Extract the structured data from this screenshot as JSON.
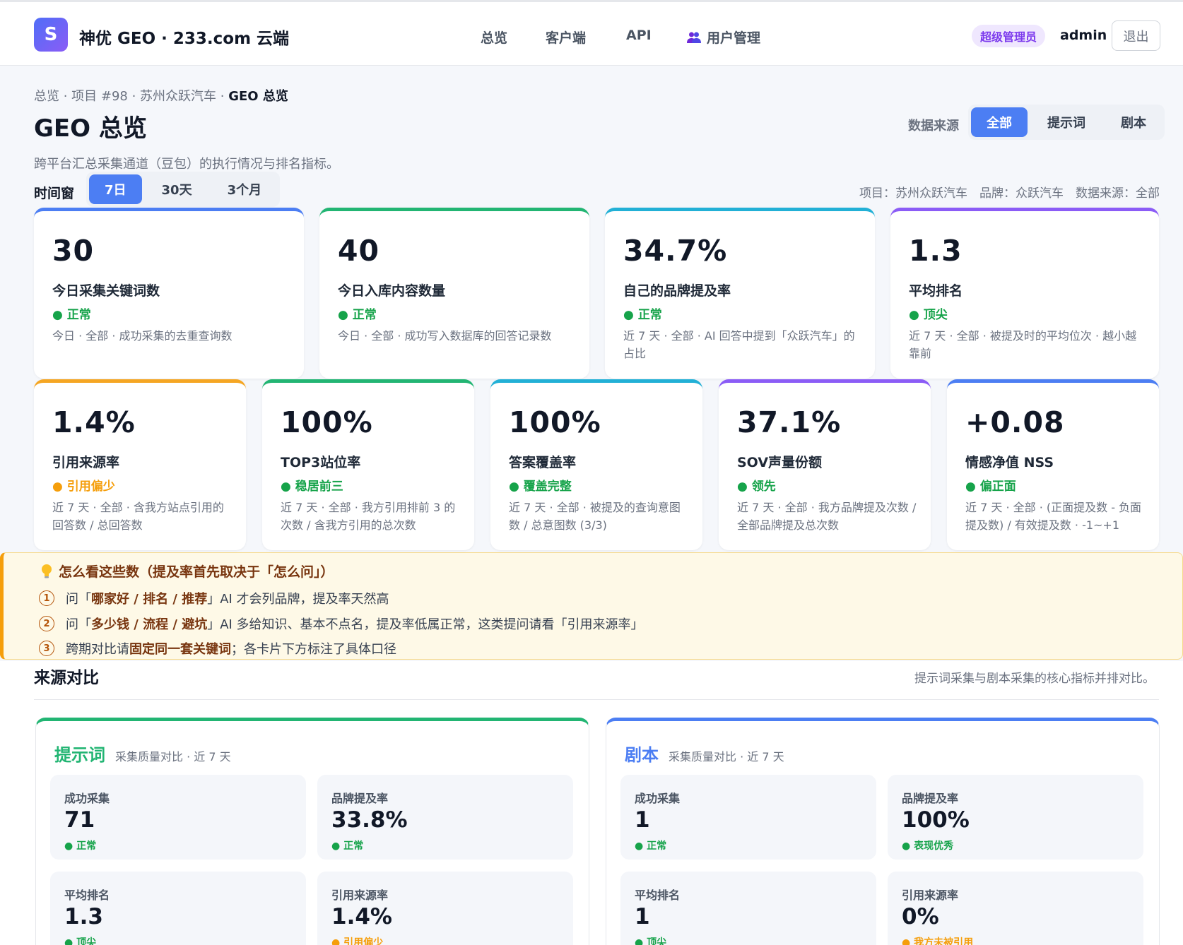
{
  "header": {
    "logo_letter": "S",
    "brand": "神优 GEO · 233.com 云端",
    "nav": [
      "总览",
      "客户端",
      "API",
      "用户管理"
    ],
    "role": "超级管理员",
    "user": "admin",
    "logout": "退出"
  },
  "page": {
    "breadcrumb_prefix": "总览 · 项目 #98 · 苏州众跃汽车 · ",
    "breadcrumb_current": "GEO 总览",
    "title": "GEO 总览",
    "subtitle": "跨平台汇总采集通道（豆包）的执行情况与排名指标。",
    "source_label": "数据来源",
    "source_options": [
      "全部",
      "提示词",
      "剧本"
    ],
    "source_selected": "全部",
    "time_label": "时间窗",
    "time_options": [
      "7日",
      "30天",
      "3个月"
    ],
    "time_selected": "7日",
    "meta": "项目：苏州众跃汽车　品牌：众跃汽车　数据来源：全部"
  },
  "stats_row1": [
    {
      "value": "30",
      "label": "今日采集关键词数",
      "status": "● 正常",
      "status_color": "green",
      "desc": "今日 · 全部 · 成功采集的去重查询数",
      "accent": "#4c7ef3"
    },
    {
      "value": "40",
      "label": "今日入库内容数量",
      "status": "● 正常",
      "status_color": "green",
      "desc": "今日 · 全部 · 成功写入数据库的回答记录数",
      "accent": "#22b573"
    },
    {
      "value": "34.7%",
      "label": "自己的品牌提及率",
      "status": "● 正常",
      "status_color": "green",
      "desc": "近 7 天 · 全部 · AI 回答中提到「众跃汽车」的占比",
      "accent": "#22b0d6"
    },
    {
      "value": "1.3",
      "label": "平均排名",
      "status": "● 顶尖",
      "status_color": "green",
      "desc": "近 7 天 · 全部 · 被提及时的平均位次 · 越小越靠前",
      "accent": "#8b5cf6"
    }
  ],
  "stats_row2": [
    {
      "value": "1.4%",
      "label": "引用来源率",
      "status": "● 引用偏少",
      "status_color": "orange",
      "desc": "近 7 天 · 全部 · 含我方站点引用的回答数 / 总回答数",
      "accent": "#f5a623"
    },
    {
      "value": "100%",
      "label": "TOP3站位率",
      "status": "● 稳居前三",
      "status_color": "green",
      "desc": "近 7 天 · 全部 · 我方引用排前 3 的次数 / 含我方引用的总次数",
      "accent": "#22b573"
    },
    {
      "value": "100%",
      "label": "答案覆盖率",
      "status": "● 覆盖完整",
      "status_color": "green",
      "desc": "近 7 天 · 全部 · 被提及的查询意图数 / 总意图数 (3/3)",
      "accent": "#22b0d6"
    },
    {
      "value": "37.1%",
      "label": "SOV声量份额",
      "status": "● 领先",
      "status_color": "green",
      "desc": "近 7 天 · 全部 · 我方品牌提及次数 / 全部品牌提及总次数",
      "accent": "#8b5cf6"
    },
    {
      "value": "+0.08",
      "label": "情感净值 NSS",
      "status": "● 偏正面",
      "status_color": "green",
      "desc": "近 7 天 · 全部 · (正面提及数 - 负面提及数) / 有效提及数 · -1~+1",
      "accent": "#4c7ef3"
    }
  ],
  "tips": {
    "title": "怎么看这些数（提及率首先取决于「怎么问」）",
    "items": [
      {
        "num": "1",
        "pre": "问「",
        "bold": "哪家好 / 排名 / 推荐",
        "post": "」AI 才会列品牌，提及率天然高"
      },
      {
        "num": "2",
        "pre": "问「",
        "bold": "多少钱 / 流程 / 避坑",
        "post": "」AI 多给知识、基本不点名，提及率低属正常，这类提问请看「引用来源率」"
      },
      {
        "num": "3",
        "pre": "跨期对比请",
        "bold": "固定同一套关键词",
        "post": "；各卡片下方标注了具体口径"
      }
    ]
  },
  "compare": {
    "title": "来源对比",
    "subtitle": "提示词采集与剧本采集的核心指标并排对比。",
    "panels": [
      {
        "name": "提示词",
        "name_color": "#22b573",
        "sub": "采集质量对比 · 近 7 天",
        "accent": "#22b573",
        "metrics": [
          {
            "label": "成功采集",
            "value": "71",
            "status": "● 正常",
            "status_color": "green"
          },
          {
            "label": "品牌提及率",
            "value": "33.8%",
            "status": "● 正常",
            "status_color": "green"
          },
          {
            "label": "平均排名",
            "value": "1.3",
            "status": "● 顶尖",
            "status_color": "green"
          },
          {
            "label": "引用来源率",
            "value": "1.4%",
            "status": "● 引用偏少",
            "status_color": "orange"
          }
        ]
      },
      {
        "name": "剧本",
        "name_color": "#4c7ef3",
        "sub": "采集质量对比 · 近 7 天",
        "accent": "#4c7ef3",
        "metrics": [
          {
            "label": "成功采集",
            "value": "1",
            "status": "● 正常",
            "status_color": "green"
          },
          {
            "label": "品牌提及率",
            "value": "100%",
            "status": "● 表现优秀",
            "status_color": "green"
          },
          {
            "label": "平均排名",
            "value": "1",
            "status": "● 顶尖",
            "status_color": "green"
          },
          {
            "label": "引用来源率",
            "value": "0%",
            "status": "● 我方未被引用",
            "status_color": "orange"
          }
        ]
      }
    ]
  }
}
